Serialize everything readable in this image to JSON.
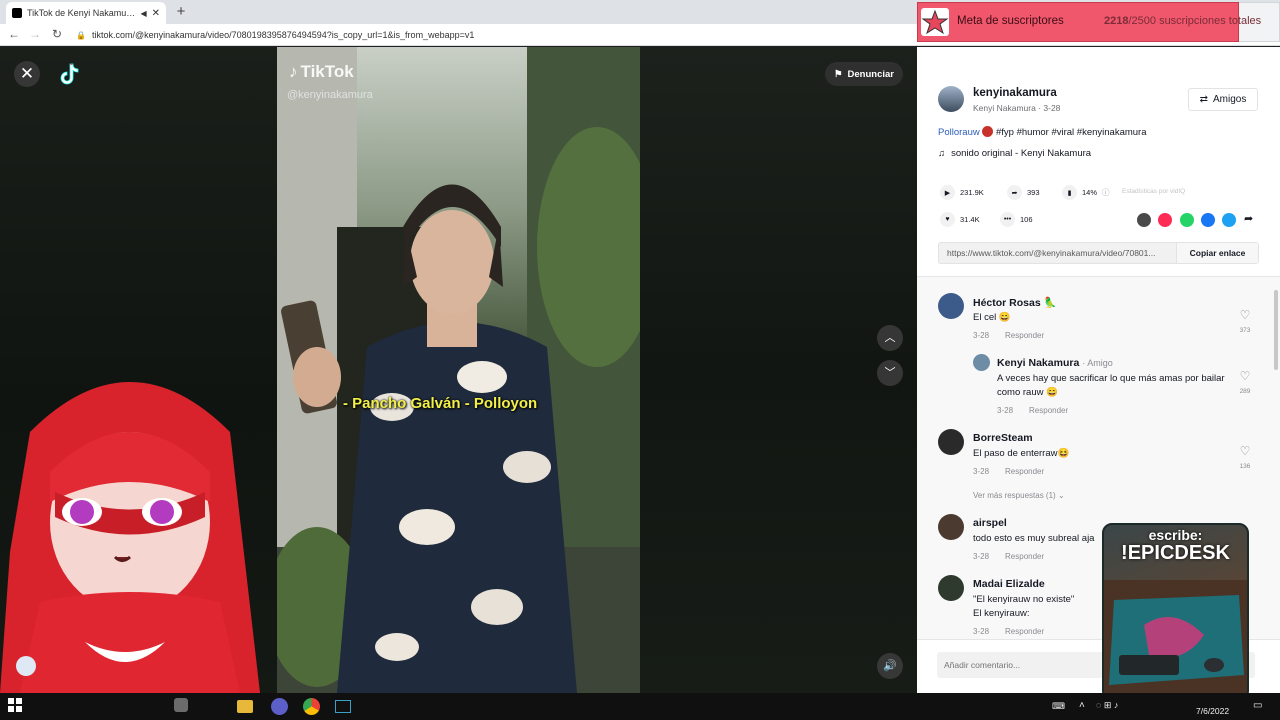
{
  "browser": {
    "tab_title": "TikTok de Kenyi Nakamura (@",
    "url": "tiktok.com/@kenyinakamura/video/7080198395876494594?is_copy_url=1&is_from_webapp=v1"
  },
  "subscriber_goal": {
    "label": "Meta de suscriptores",
    "current": "2218",
    "goal_text": "/2500 suscripciones totales",
    "progress": 0.8872
  },
  "video": {
    "report_label": "Denunciar",
    "watermark_brand": "TikTok",
    "watermark_handle": "@kenyinakamura",
    "caption": "- Pancho Galván - Polloyon"
  },
  "author": {
    "username": "kenyinakamura",
    "subline": "Kenyi Nakamura · 3-28",
    "friends_label": "Amigos"
  },
  "post": {
    "description_name": "Pollorauw",
    "description_tags": "#fyp #humor #viral #kenyinakamura",
    "music": "sonido original - Kenyi Nakamura"
  },
  "stats": {
    "views": "231.9K",
    "shares": "393",
    "percent": "14%",
    "vidiq": "Estadísticas por vidIQ",
    "likes": "31.4K",
    "comments": "106"
  },
  "share_icons": [
    "embed-icon",
    "send-icon",
    "whatsapp-icon",
    "facebook-icon",
    "twitter-icon",
    "share-arrow-icon"
  ],
  "share_colors": [
    "#4a4a4a",
    "#fe2c55",
    "#25d366",
    "#1877f2",
    "#1da1f2"
  ],
  "link": {
    "url": "https://www.tiktok.com/@kenyinakamura/video/70801...",
    "copy_label": "Copiar enlace"
  },
  "comments": [
    {
      "name": "Héctor Rosas",
      "emoji": "🦜",
      "text": "El cel 😄",
      "date": "3-28",
      "reply": "Responder",
      "likes": "373"
    },
    {
      "name": "Kenyi Nakamura",
      "tag": "· Amigo",
      "text": "A veces hay que sacrificar lo que más amas por bailar como rauw 😄",
      "date": "3-28",
      "reply": "Responder",
      "likes": "289"
    },
    {
      "name": "BorreSteam",
      "text": "El paso de enterraw😆",
      "date": "3-28",
      "reply": "Responder",
      "likes": "136"
    },
    {
      "name": "airspel",
      "text": "todo esto es muy subreal aja",
      "date": "3-28",
      "reply": "Responder"
    },
    {
      "name": "Madai Elizalde",
      "text": "\"El kenyirauw no existe\"",
      "text2": "El kenyirauw:",
      "date": "3-28",
      "reply": "Responder"
    }
  ],
  "more_replies": "Ver más respuestas (1)",
  "comment_input_placeholder": "Añadir comentario...",
  "ad": {
    "line1": "escribe:",
    "line2": "!EPICDESK"
  },
  "taskbar": {
    "date": "7/6/2022"
  }
}
